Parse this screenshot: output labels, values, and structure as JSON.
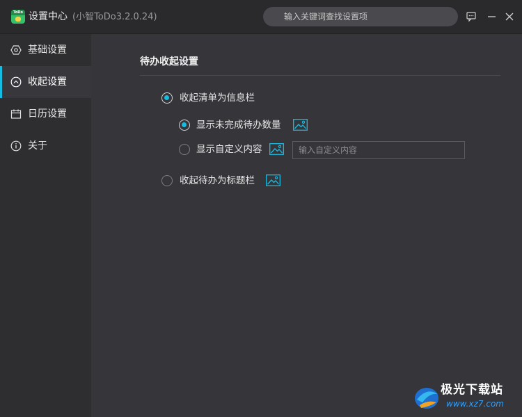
{
  "window": {
    "logo_text": "ToDo",
    "title": "设置中心",
    "version": "(小智ToDo3.2.0.24)",
    "search_placeholder": "输入关键词查找设置项"
  },
  "sidebar": {
    "items": [
      {
        "label": "基础设置",
        "icon": "hexagon-settings-icon",
        "active": false
      },
      {
        "label": "收起设置",
        "icon": "collapse-up-icon",
        "active": true
      },
      {
        "label": "日历设置",
        "icon": "calendar-icon",
        "active": false
      },
      {
        "label": "关于",
        "icon": "info-icon",
        "active": false
      }
    ]
  },
  "main": {
    "section_title": "待办收起设置",
    "options": {
      "collapse_to_info_bar": {
        "label": "收起清单为信息栏",
        "checked": true
      },
      "show_incomplete_count": {
        "label": "显示未完成待办数量",
        "checked": true
      },
      "show_custom_content": {
        "label": "显示自定义内容",
        "checked": false
      },
      "collapse_to_title_bar": {
        "label": "收起待办为标题栏",
        "checked": false
      }
    },
    "custom_input": {
      "value": "",
      "placeholder": "输入自定义内容"
    }
  },
  "watermark": {
    "brand": "极光下载站",
    "url": "www.xz7.com"
  },
  "colors": {
    "accent": "#16bde3",
    "background": "#36353a",
    "sidebar": "#2e2e31",
    "titlebar": "#2a2a2d"
  }
}
